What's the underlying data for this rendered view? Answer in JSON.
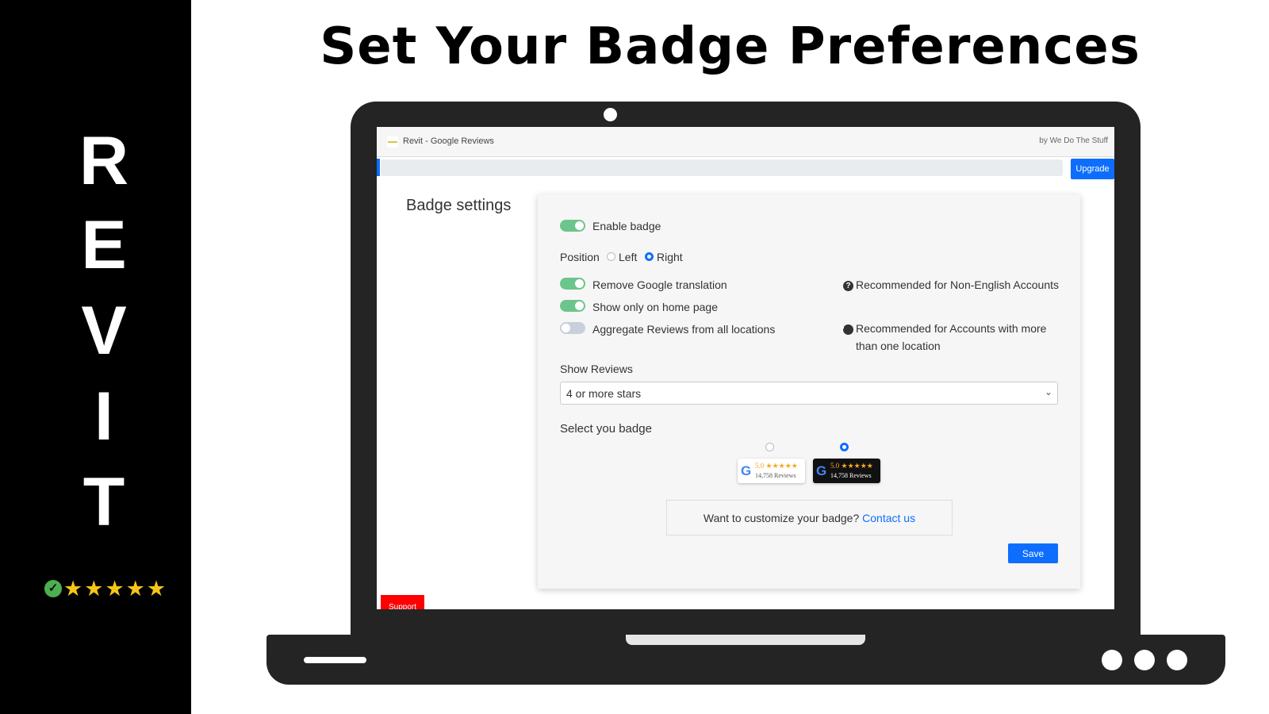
{
  "sidebar": {
    "letters": [
      "R",
      "E",
      "V",
      "I",
      "T"
    ],
    "rating_stars": 5,
    "check_icon": "check-circle-icon",
    "colors": {
      "check": "#4caf50",
      "star": "#f5c518"
    }
  },
  "heading": "Set Your Badge Preferences",
  "app": {
    "title": "Revit - Google Reviews",
    "by": "by We Do The Stuff",
    "upgrade_label": "Upgrade",
    "support_label": "Support"
  },
  "settings": {
    "page_title": "Badge settings",
    "enable_badge": {
      "label": "Enable badge",
      "on": true
    },
    "position": {
      "label": "Position",
      "options": [
        "Left",
        "Right"
      ],
      "selected": "Right"
    },
    "remove_translation": {
      "label": "Remove Google translation",
      "on": true,
      "hint": "Recommended for Non-English Accounts"
    },
    "home_only": {
      "label": "Show only on home page",
      "on": true
    },
    "aggregate": {
      "label": "Aggregate Reviews from all locations",
      "on": false,
      "hint": "Recommended for Accounts with more than one location"
    },
    "show_reviews": {
      "label": "Show Reviews",
      "value": "4 or more stars"
    },
    "select_badge": {
      "label": "Select you badge",
      "selected": "dark",
      "badges": [
        {
          "style": "light",
          "g": "G",
          "rating": "5.0 ★★★★★",
          "count": "14,758 Reviews"
        },
        {
          "style": "dark",
          "g": "G",
          "rating": "5.0 ★★★★★",
          "count": "14,758 Reviews"
        }
      ]
    },
    "customize": {
      "text": "Want to customize your badge? ",
      "link": "Contact us"
    },
    "save_label": "Save"
  },
  "colors": {
    "accent": "#0d6efd",
    "toggle_on": "#6cc58a",
    "support": "#ff0000"
  }
}
